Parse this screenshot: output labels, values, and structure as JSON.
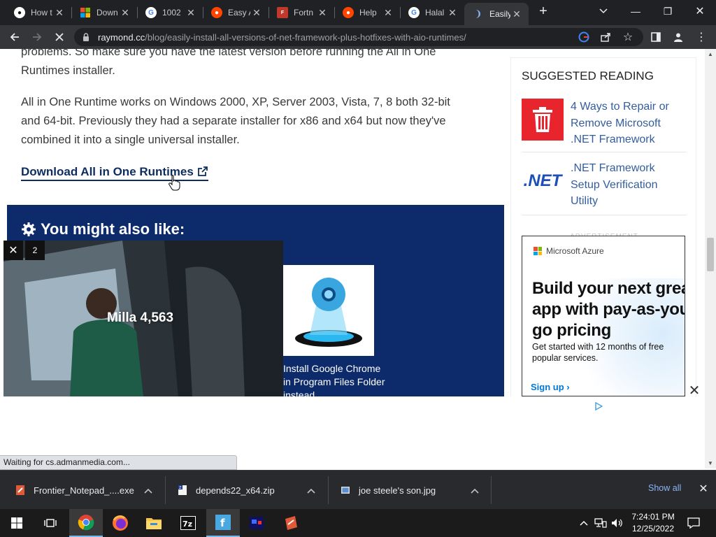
{
  "browser": {
    "tabs": [
      {
        "title": "How t",
        "icon": "github-icon"
      },
      {
        "title": "Down",
        "icon": "microsoft-icon"
      },
      {
        "title": "1002",
        "icon": "google-icon"
      },
      {
        "title": "Easy A",
        "icon": "reddit-icon"
      },
      {
        "title": "Fortn",
        "icon": "fortnite-icon"
      },
      {
        "title": "Help",
        "icon": "reddit-icon"
      },
      {
        "title": "Halal",
        "icon": "google-icon"
      },
      {
        "title": "Easily",
        "icon": "loading-icon",
        "active": true
      }
    ],
    "url_domain": "raymond.cc",
    "url_path": "/blog/easily-install-all-versions-of-net-framework-plus-hotfixes-with-aio-runtimes/",
    "status_text": "Waiting for cs.admanmedia.com..."
  },
  "article": {
    "para1_line1": "problems. So make sure you have the latest version before running the All in One",
    "para1_line2": "Runtimes installer.",
    "para2_line1": "All in One Runtime works on Windows 2000, XP, Server 2003, Vista, 7, 8 both 32-bit",
    "para2_line2": "and 64-bit. Previously they had a separate installer for x86 and x64 but now they've",
    "para2_line3": "combined it into a single universal installer.",
    "download_link": "Download All in One Runtimes"
  },
  "also_like": {
    "title": "You might also like:",
    "item_caption": "Install Google Chrome in Program Files Folder instead"
  },
  "video_ad": {
    "label": "Milla 4,563",
    "counter": "2"
  },
  "sidebar": {
    "title": "SUGGESTED READING",
    "items": [
      {
        "title": "4 Ways to Repair or Remove Microsoft .NET Framework"
      },
      {
        "title": ".NET Framework Setup Verification Utility"
      }
    ],
    "net_logo_text": ".NET",
    "ad_label": "ADVERTISEMENT"
  },
  "azure_ad": {
    "brand": "Microsoft Azure",
    "headline": "Build your next great app with pay-as-you-go pricing",
    "subtext": "Get started with 12 months of free popular services.",
    "cta": "Sign up ›"
  },
  "downloads": [
    {
      "name": "Frontier_Notepad_....exe"
    },
    {
      "name": "depends22_x64.zip"
    },
    {
      "name": "joe steele's son.jpg"
    }
  ],
  "downloads_show_all": "Show all",
  "taskbar": {
    "apps": [
      "chrome",
      "firefox",
      "file-explorer",
      "7zip",
      "frontier-notepad",
      "app-blue",
      "app-red"
    ],
    "time": "7:24:01 PM",
    "date": "12/25/2022"
  }
}
